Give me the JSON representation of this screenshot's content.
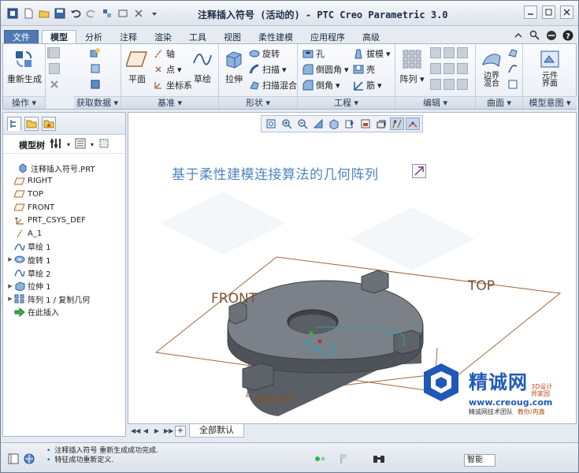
{
  "window": {
    "title": "注释插入符号 (活动的) - PTC Creo Parametric 3.0"
  },
  "tabs": [
    {
      "label": "文件",
      "name": "tab-file"
    },
    {
      "label": "模型",
      "name": "tab-model"
    },
    {
      "label": "分析",
      "name": "tab-analysis"
    },
    {
      "label": "注释",
      "name": "tab-annotate"
    },
    {
      "label": "渲染",
      "name": "tab-render"
    },
    {
      "label": "工具",
      "name": "tab-tools"
    },
    {
      "label": "视图",
      "name": "tab-view"
    },
    {
      "label": "柔性建模",
      "name": "tab-flexible-modeling"
    },
    {
      "label": "应用程序",
      "name": "tab-applications"
    },
    {
      "label": "高级",
      "name": "tab-advanced"
    }
  ],
  "ribbon": {
    "operations": {
      "label": "操作",
      "regenerate": "重新生成"
    },
    "get_data": {
      "label": "获取数据"
    },
    "datum": {
      "label": "基准",
      "plane": "平面",
      "axis": "轴",
      "point": "点",
      "csys": "坐标系",
      "sketch": "草绘"
    },
    "shapes": {
      "label": "形状",
      "extrude": "拉伸",
      "revolve": "旋转",
      "sweep": "扫描",
      "swept_blend": "扫描混合"
    },
    "engineering": {
      "label": "工程",
      "hole": "孔",
      "round": "倒圆角",
      "chamfer": "倒角",
      "draft": "拔模",
      "shell": "壳",
      "rib": "筋"
    },
    "editing": {
      "label": "编辑",
      "pattern": "阵列"
    },
    "surfaces": {
      "label": "曲面",
      "boundary_blend": "边界\n混合"
    },
    "model_intent": {
      "label": "模型意图",
      "component_interface": "元件\n界面"
    }
  },
  "model_tree": {
    "title": "模型树",
    "items": [
      {
        "label": "注释插入符号.PRT",
        "icon": "part-icon",
        "expandable": false
      },
      {
        "label": "RIGHT",
        "icon": "datum-plane-icon",
        "expandable": false
      },
      {
        "label": "TOP",
        "icon": "datum-plane-icon",
        "expandable": false
      },
      {
        "label": "FRONT",
        "icon": "datum-plane-icon",
        "expandable": false
      },
      {
        "label": "PRT_CSYS_DEF",
        "icon": "csys-icon",
        "expandable": false
      },
      {
        "label": "A_1",
        "icon": "axis-icon",
        "expandable": false
      },
      {
        "label": "草绘 1",
        "icon": "sketch-icon",
        "expandable": false
      },
      {
        "label": "旋转 1",
        "icon": "revolve-icon",
        "expandable": true
      },
      {
        "label": "草绘 2",
        "icon": "sketch-icon",
        "expandable": false
      },
      {
        "label": "拉伸 1",
        "icon": "extrude-icon",
        "expandable": true
      },
      {
        "label": "阵列 1 / 复制几何",
        "icon": "pattern-icon",
        "expandable": true
      },
      {
        "label": "在此插入",
        "icon": "insert-arrow-icon",
        "expandable": false
      }
    ]
  },
  "graphics": {
    "annotation": "基于柔性建模连接算法的几何阵列",
    "planes": {
      "front": "FRONT",
      "top": "TOP",
      "right": "RIGHT"
    },
    "axis": "A_1",
    "watermark": {
      "brand": "精诚网",
      "sub": "3D设计\n师家园",
      "url": "www.creoug.com",
      "slogan": "精诚网技术团队",
      "author": "教你/冉鑫"
    }
  },
  "bottom_tabs": {
    "all_default": "全部默认"
  },
  "status": {
    "messages": [
      "注释插入符号 重新生成成功完成.",
      "特征成功重新定义."
    ],
    "filter_value": "智能"
  },
  "colors": {
    "accent": "#5079b4",
    "annotation": "#4e86bf",
    "plane": "#a0683a",
    "part": "#6c7178"
  }
}
